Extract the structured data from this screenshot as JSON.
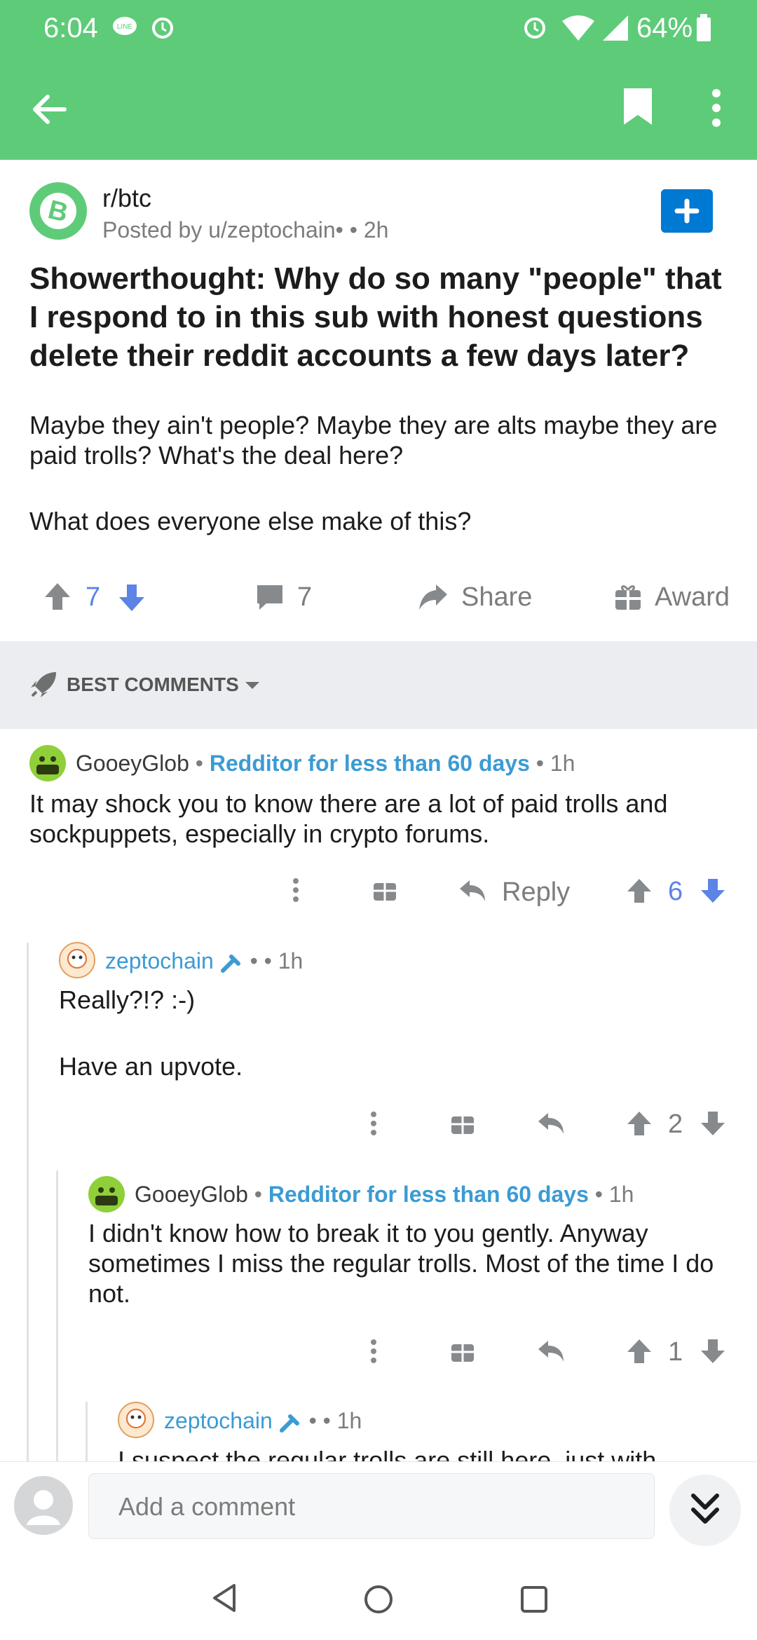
{
  "status_bar": {
    "time": "6:04",
    "battery": "64%"
  },
  "app_bar": {
    "back_label": "back",
    "icons": [
      "bookmark-icon",
      "more-vert-icon"
    ]
  },
  "post": {
    "subreddit": "r/btc",
    "posted_by": "Posted by u/zeptochain• ",
    "age": "• 2h",
    "title": "Showerthought: Why do so many \"people\" that I respond to in this sub with honest questions delete their reddit accounts a few days later?",
    "body_1": "Maybe they ain't people? Maybe they are alts maybe they are paid trolls? What's the deal here?",
    "body_2": "What does everyone else make of this?",
    "votes": "7",
    "comments": "7",
    "share_label": "Share",
    "award_label": "Award"
  },
  "sort": {
    "label": "BEST COMMENTS"
  },
  "comments": [
    {
      "user": "GooeyGlob",
      "flair": "Redditor for less than 60 days",
      "age": "1h",
      "text": "It may shock you to know there are a lot of paid trolls and sockpuppets,  especially in crypto forums.",
      "reply_label": "Reply",
      "votes": "6"
    },
    {
      "user": "zeptochain",
      "age": "1h",
      "text_1": "Really?!? :-)",
      "text_2": "Have an upvote.",
      "votes": "2"
    },
    {
      "user": "GooeyGlob",
      "flair": "Redditor for less than 60 days",
      "age": "1h",
      "text": "I didn't know how to break it to you gently. Anyway sometimes I miss the regular trolls. Most of the time I do not.",
      "votes": "1"
    },
    {
      "user": "zeptochain",
      "age": "1h",
      "text": "I suspect the regular trolls are still here, just with"
    }
  ],
  "composer": {
    "placeholder": "Add a comment"
  },
  "colors": {
    "header_green": "#5ecb79",
    "link_blue": "#3b9bd4",
    "vote_blue": "#5b84e6",
    "button_blue": "#0079d3"
  }
}
